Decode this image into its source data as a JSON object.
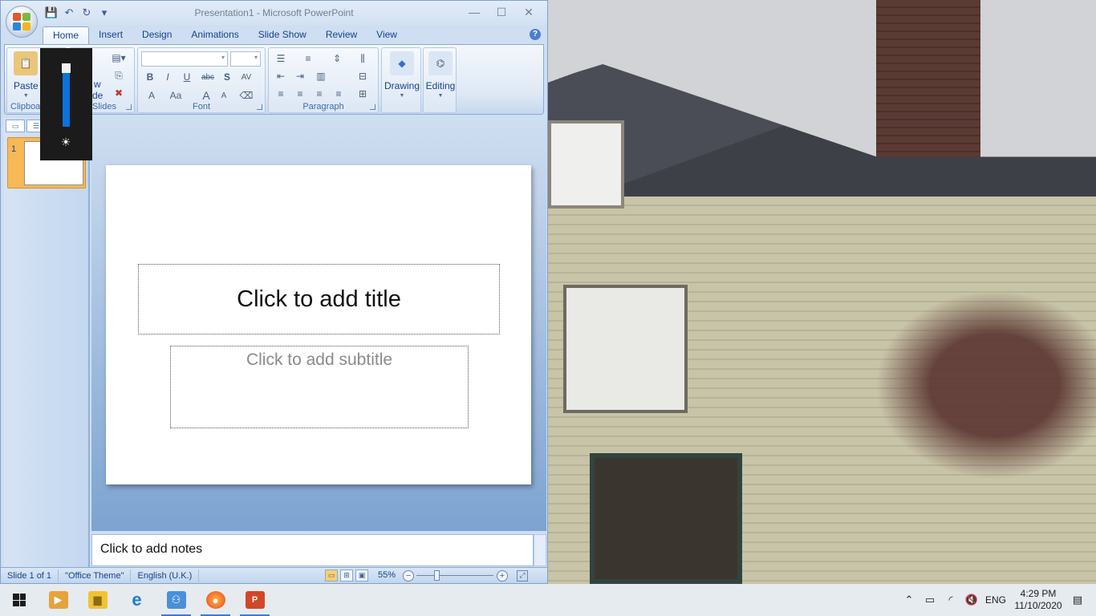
{
  "window": {
    "title": "Presentation1 - Microsoft PowerPoint",
    "minimize": "—",
    "maximize": "☐",
    "close": "✕"
  },
  "tabs": [
    "Home",
    "Insert",
    "Design",
    "Animations",
    "Slide Show",
    "Review",
    "View"
  ],
  "ribbon": {
    "clipboard": {
      "paste": "Paste",
      "label": "Clipboa"
    },
    "slides": {
      "new": "w",
      "layout": "de",
      "label": "Slides"
    },
    "font": {
      "label": "Font",
      "bold": "B",
      "italic": "I",
      "underline": "U",
      "strike": "abc",
      "shadow": "S",
      "spacing": "AV",
      "color": "A",
      "case": "Aa",
      "grow": "A",
      "shrink": "A"
    },
    "paragraph": {
      "label": "Paragraph"
    },
    "drawing": {
      "label": "Drawing"
    },
    "editing": {
      "label": "Editing"
    }
  },
  "brightness": {
    "level_percent": 100
  },
  "slides_pane": {
    "slide_number": "1"
  },
  "slide": {
    "title_placeholder": "Click to add title",
    "subtitle_placeholder": "Click to add subtitle"
  },
  "notes": {
    "placeholder": "Click to add notes"
  },
  "statusbar": {
    "slide": "Slide 1 of 1",
    "theme": "\"Office Theme\"",
    "language": "English (U.K.)",
    "zoom": "55%"
  },
  "taskbar": {
    "tray": {
      "language": "ENG",
      "time": "4:29 PM",
      "date": "11/10/2020"
    }
  },
  "colors": {
    "accent": "#15428b",
    "ribbon_bg": "#dfe9f5",
    "thumb_selected": "#f7b858",
    "brightness_bar": "#0a74d8"
  }
}
